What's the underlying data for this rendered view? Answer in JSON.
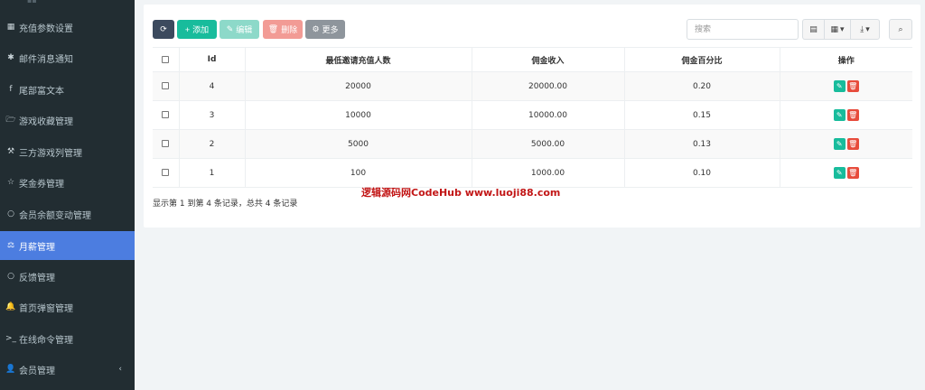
{
  "sidebar": {
    "items": [
      {
        "label": "充值参数设置",
        "icon": "grid-icon",
        "glyph": "▦"
      },
      {
        "label": "邮件消息通知",
        "icon": "asterisk-icon",
        "glyph": "✱"
      },
      {
        "label": "尾部富文本",
        "icon": "facebook-icon",
        "glyph": "f"
      },
      {
        "label": "游戏收藏管理",
        "icon": "folder-open-icon",
        "glyph": "🗁"
      },
      {
        "label": "三方游戏列管理",
        "icon": "gavel-icon",
        "glyph": "⚒"
      },
      {
        "label": "奖金券管理",
        "icon": "star-icon",
        "glyph": "☆"
      },
      {
        "label": "会员余额变动管理",
        "icon": "circle-icon",
        "glyph": "○"
      },
      {
        "label": "月薪管理",
        "icon": "balance-scale-icon",
        "glyph": "⚖"
      },
      {
        "label": "反馈管理",
        "icon": "circle-icon",
        "glyph": "○"
      },
      {
        "label": "首页弹窗管理",
        "icon": "bell-icon",
        "glyph": "🔔"
      },
      {
        "label": "在线命令管理",
        "icon": "terminal-icon",
        "glyph": ">_"
      },
      {
        "label": "会员管理",
        "icon": "user-circle-icon",
        "glyph": "👤"
      }
    ],
    "collapse_glyph": "‹"
  },
  "toolbar": {
    "refresh_glyph": "⟳",
    "add_label": "添加",
    "edit_label": "编辑",
    "delete_label": "删除",
    "more_label": "更多",
    "search_placeholder": "搜索"
  },
  "table": {
    "columns": [
      "Id",
      "最低邀请充值人数",
      "佣金收入",
      "佣金百分比",
      "操作"
    ],
    "rows": [
      {
        "id": "4",
        "min_invite": "20000",
        "income": "20000.00",
        "percent": "0.20"
      },
      {
        "id": "3",
        "min_invite": "10000",
        "income": "10000.00",
        "percent": "0.15"
      },
      {
        "id": "2",
        "min_invite": "5000",
        "income": "5000.00",
        "percent": "0.13"
      },
      {
        "id": "1",
        "min_invite": "100",
        "income": "1000.00",
        "percent": "0.10"
      }
    ]
  },
  "pagination_text": "显示第 1 到第 4 条记录，总共 4 条记录",
  "watermark": "逻辑源码网CodeHub  www.luoji88.com",
  "colors": {
    "sidebar_bg": "#222d32",
    "sidebar_active": "#4c7de0",
    "btn_add": "#18bc9c",
    "btn_delete": "#e74c3c",
    "btn_refresh": "#3c4a5e"
  }
}
